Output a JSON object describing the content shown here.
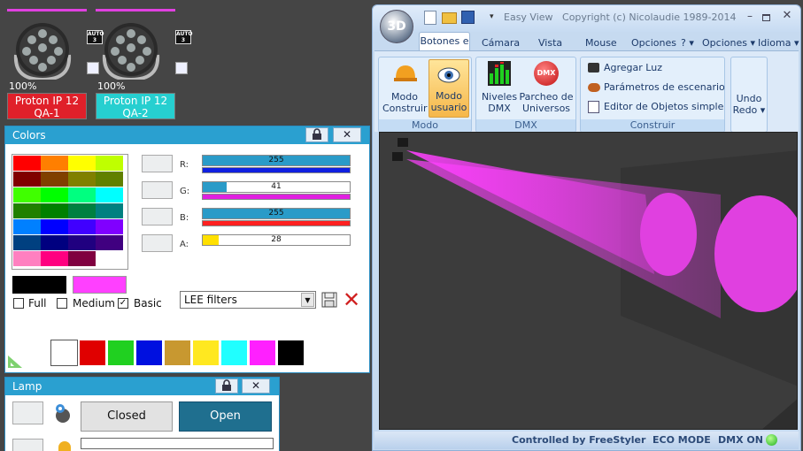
{
  "fixtures": [
    {
      "percent": "100%",
      "name_line1": "Proton IP 12",
      "name_line2": "QA-1",
      "label_color": "#e0202a",
      "bar_color": "#e040e0",
      "auto": [
        "AUTO",
        "3"
      ]
    },
    {
      "percent": "100%",
      "name_line1": "Proton IP 12",
      "name_line2": "QA-2",
      "label_color": "#26cfd0",
      "bar_color": "#e040e0",
      "auto": [
        "AUTO",
        "3"
      ]
    }
  ],
  "colors_panel": {
    "title": "Colors",
    "grid": [
      "#ff0000",
      "#ff7f00",
      "#ffff00",
      "#bfff00",
      "#800000",
      "#804000",
      "#808000",
      "#608000",
      "#40ff00",
      "#00ff00",
      "#00ff80",
      "#00ffff",
      "#208000",
      "#008000",
      "#008040",
      "#008080",
      "#0080ff",
      "#0000ff",
      "#4000ff",
      "#8000ff",
      "#004080",
      "#000080",
      "#200080",
      "#400080",
      "#ff80c0",
      "#ff0080",
      "#800040",
      "#ffffff"
    ],
    "sliders": [
      {
        "label": "R:",
        "value": "255",
        "fraction": 1.0,
        "indicator": "#1020e0"
      },
      {
        "label": "G:",
        "value": "41",
        "fraction": 0.16,
        "indicator": "#e020e0"
      },
      {
        "label": "B:",
        "value": "255",
        "fraction": 1.0,
        "indicator": "#ff2020"
      },
      {
        "label": "A:",
        "value": "28",
        "fraction": 0.11,
        "fill": "#ffe000"
      }
    ],
    "preview_black": "#000000",
    "preview_color": "#ff40ff",
    "checkboxes": [
      {
        "label": "Full",
        "checked": false
      },
      {
        "label": "Medium",
        "checked": false
      },
      {
        "label": "Basic",
        "checked": true
      }
    ],
    "filter_select": "LEE filters",
    "palette": [
      "#ffffff",
      "#e00000",
      "#20d020",
      "#0010e0",
      "#c89830",
      "#ffe820",
      "#20ffff",
      "#ff20ff",
      "#000000"
    ]
  },
  "lamp_panel": {
    "title": "Lamp",
    "closed_label": "Closed",
    "open_label": "Open"
  },
  "app": {
    "logo": "3D",
    "title": "Easy View   Copyright (c) Nicolaudie 1989-2014",
    "tabs": [
      "Botones e",
      "Cámara",
      "Vista",
      "Mouse",
      "Opciones"
    ],
    "tab_help": "?",
    "right_menus": [
      "Opciones",
      "Idioma"
    ],
    "groups": {
      "modo": {
        "title": "Modo",
        "btn1": [
          "Modo",
          "Construir"
        ],
        "btn2": [
          "Modo",
          "usuario"
        ]
      },
      "dmx": {
        "title": "DMX",
        "btn1": [
          "Niveles",
          "DMX"
        ],
        "btn2": [
          "Parcheo de",
          "Universos"
        ],
        "dmx_icon": "DMX"
      },
      "construir": {
        "title": "Construir",
        "items": [
          "Agregar Luz",
          "Parámetros de escenario...",
          "Editor de Objetos simples"
        ]
      },
      "undo": [
        "Undo",
        "Redo"
      ]
    },
    "status": {
      "text1": "Controlled by FreeStyler",
      "text2": "ECO MODE",
      "text3": "DMX ON"
    }
  }
}
